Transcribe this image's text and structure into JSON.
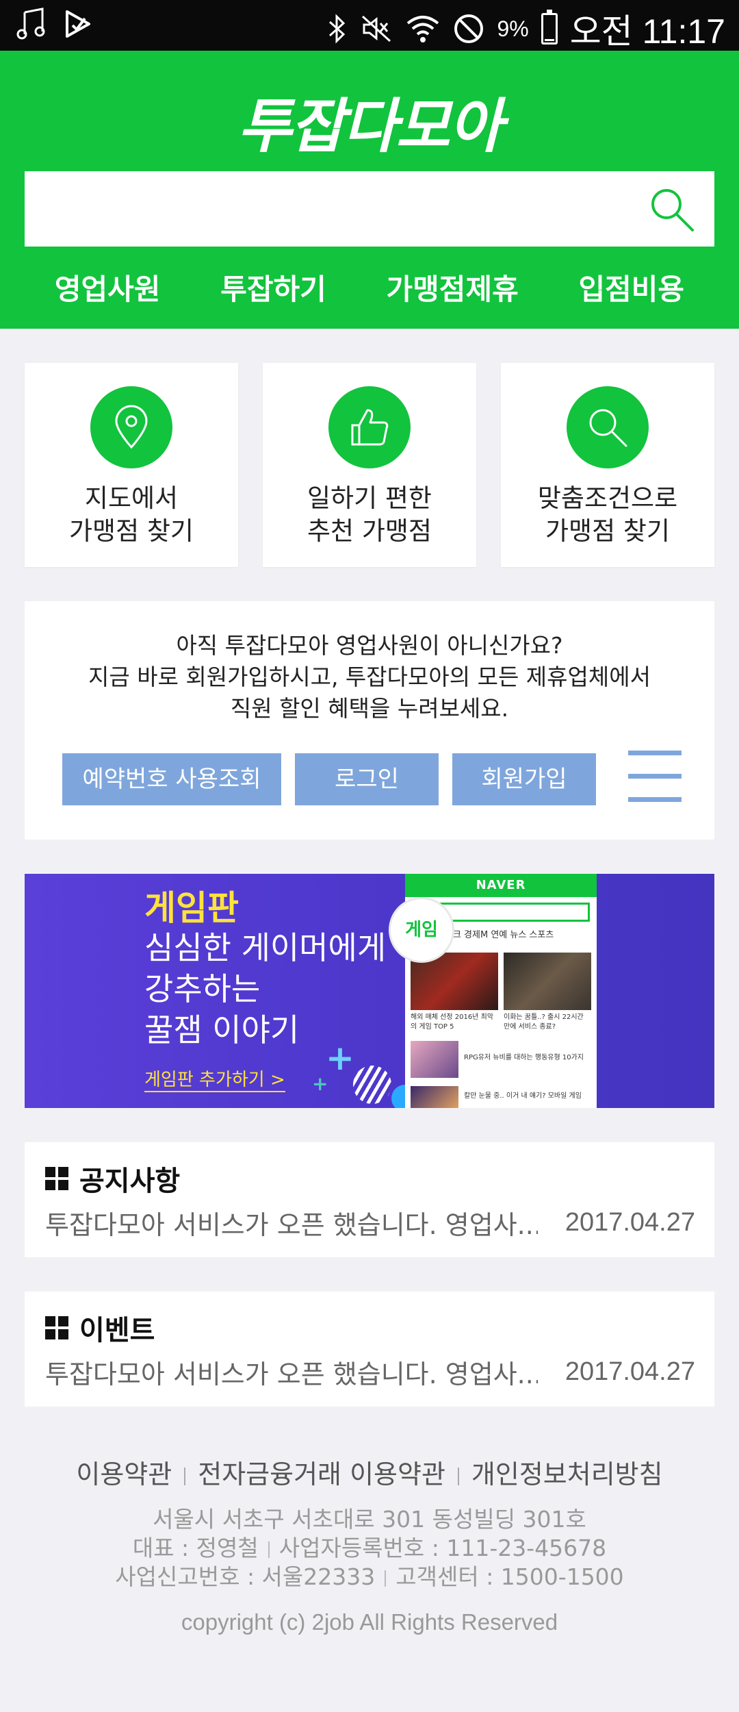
{
  "status_bar": {
    "battery_percent": "9%",
    "battery_level": 0.09,
    "time": "오전 11:17",
    "icons": [
      "music-icon",
      "play-store-icon",
      "bluetooth-icon",
      "mute-icon",
      "wifi-icon",
      "do-not-disturb-icon",
      "battery-icon"
    ]
  },
  "header": {
    "logo": "투잡다모아",
    "search": {
      "value": "",
      "placeholder": ""
    },
    "nav": [
      "영업사원",
      "투잡하기",
      "가맹점제휴",
      "입점비용"
    ]
  },
  "shortcuts": [
    {
      "icon": "map-pin-icon",
      "label": "지도에서\n가맹점 찾기"
    },
    {
      "icon": "thumbs-up-icon",
      "label": "일하기 편한\n추천 가맹점"
    },
    {
      "icon": "search-icon",
      "label": "맞춤조건으로\n가맹점 찾기"
    }
  ],
  "member": {
    "lines": [
      "아직 투잡다모아 영업사원이 아니신가요?",
      "지금 바로 회원가입하시고, 투잡다모아의 모든 제휴업체에서",
      "직원 할인 혜택을 누려보세요."
    ],
    "buttons": {
      "reservation": "예약번호 사용조회",
      "login": "로그인",
      "signup": "회원가입"
    }
  },
  "banner": {
    "title": "게임판",
    "lines": [
      "심심한 게이머에게",
      "강추하는",
      "꿀잼 이야기"
    ],
    "cta": "게임판 추가하기 >",
    "bubble": "게임",
    "phone": {
      "brand": "NAVER",
      "tabs": "베크  경제M  연예  뉴스  스포츠",
      "caption1": "해외 매체 선정 2016년 최악의 게임 TOP 5",
      "caption2": "이화는 꿈틀..? 출시 22시간 만에 서비스 종료?",
      "caption3": "RPG유저 뉴비를 대하는 행동유형 10가지",
      "caption4": "칼만 눈물 중.. 이거 내 얘기? 모바일 게임"
    }
  },
  "notice": {
    "title": "공지사항",
    "subject": "투잡다모아 서비스가 오픈 했습니다. 영업사...",
    "date": "2017.04.27"
  },
  "event": {
    "title": "이벤트",
    "subject": "투잡다모아 서비스가 오픈 했습니다. 영업사...",
    "date": "2017.04.27"
  },
  "footer": {
    "links": [
      "이용약관",
      "전자금융거래 이용약관",
      "개인정보처리방침"
    ],
    "address": "서울시 서초구 서초대로 301 동성빌딩 301호",
    "ceo": "대표 : 정영철",
    "biz_no": "사업자등록번호 : 111-23-45678",
    "report_no": "사업신고번호 : 서울22333",
    "customer_center": "고객센터 : 1500-1500",
    "copyright": "copyright (c) 2job  All Rights Reserved"
  }
}
